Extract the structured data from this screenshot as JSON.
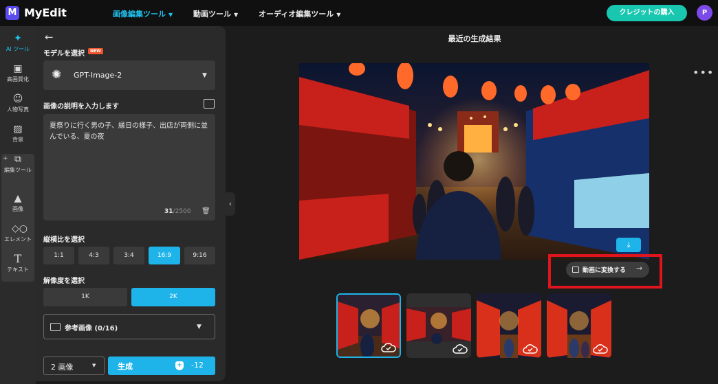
{
  "app": {
    "name": "MyEdit",
    "logo_letter": "M"
  },
  "nav": {
    "items": [
      {
        "label": "画像編集ツール",
        "active": true
      },
      {
        "label": "動画ツール",
        "active": false
      },
      {
        "label": "オーディオ編集ツール",
        "active": false
      }
    ],
    "credit_button": "クレジットの購入",
    "avatar_initial": "P"
  },
  "rail": {
    "items": [
      {
        "label": "AI ツール",
        "icon": "magic-wand-icon",
        "active": true
      },
      {
        "label": "高画質化",
        "icon": "enhance-icon",
        "active": false
      },
      {
        "label": "人物写真",
        "icon": "portrait-icon",
        "active": false
      },
      {
        "label": "背景",
        "icon": "background-icon",
        "active": false
      },
      {
        "label": "編集ツール",
        "icon": "crop-icon",
        "active": false
      },
      {
        "label": "画像",
        "icon": "image-icon",
        "active": false
      },
      {
        "label": "エレメント",
        "icon": "shapes-icon",
        "active": false
      },
      {
        "label": "テキスト",
        "icon": "text-icon",
        "active": false
      }
    ]
  },
  "panel": {
    "model_label": "モデルを選択",
    "new_badge": "NEW",
    "model_value": "GPT-Image-2",
    "prompt_label": "画像の説明を入力します",
    "prompt_text": "夏祭りに行く男の子、縁日の様子、出店が両側に並んでいる、夏の夜",
    "char_count": "31",
    "char_limit": "/2500",
    "ratio_label": "縦横比を選択",
    "ratios": [
      {
        "label": "1:1",
        "active": false
      },
      {
        "label": "4:3",
        "active": false
      },
      {
        "label": "3:4",
        "active": false
      },
      {
        "label": "16:9",
        "active": true
      },
      {
        "label": "9:16",
        "active": false
      }
    ],
    "resolution_label": "解像度を選択",
    "resolutions": [
      {
        "label": "1K",
        "active": false
      },
      {
        "label": "2K",
        "active": true
      }
    ],
    "reference_label": "参考画像 (0/16)",
    "image_count": "2 画像",
    "generate_label": "生成",
    "generate_cost": "-12"
  },
  "main": {
    "title": "最近の生成結果",
    "convert_label": "動画に変換する",
    "thumbnails": [
      {
        "selected": true
      },
      {
        "selected": false
      },
      {
        "selected": false
      },
      {
        "selected": false
      }
    ]
  },
  "colors": {
    "accent": "#1eb4ea",
    "credit": "#19c6b0",
    "highlight": "#e0141c",
    "avatar": "#7b4ae8"
  }
}
